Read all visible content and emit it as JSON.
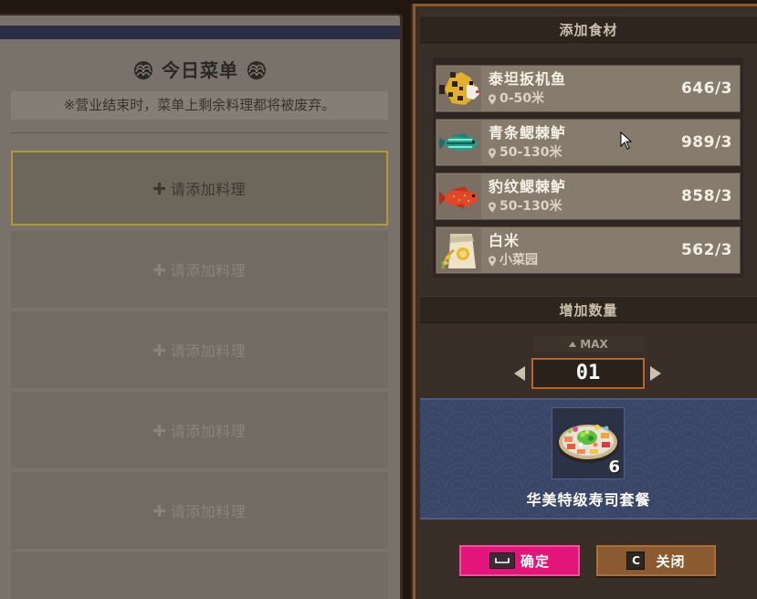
{
  "menu": {
    "title": "今日菜单",
    "notice": "※营业结束时，菜单上剩余料理都将被废弃。",
    "slots": [
      "请添加料理",
      "请添加料理",
      "请添加料理",
      "请添加料理",
      "请添加料理"
    ]
  },
  "ingredients": {
    "title": "添加食材",
    "items": [
      {
        "name": "泰坦扳机鱼",
        "location": "0-50米",
        "count": "646/3",
        "icon": "titan-triggerfish-icon"
      },
      {
        "name": "青条鳃棘鲈",
        "location": "50-130米",
        "count": "989/3",
        "icon": "blue-lined-coral-grouper-icon"
      },
      {
        "name": "豹纹鳃棘鲈",
        "location": "50-130米",
        "count": "858/3",
        "icon": "leopard-coral-grouper-icon"
      },
      {
        "name": "白米",
        "location": "小菜园",
        "count": "562/3",
        "icon": "rice-bag-icon"
      }
    ]
  },
  "quantity": {
    "title": "增加数量",
    "max_label": "MAX",
    "value": "01"
  },
  "dish": {
    "name": "华美特级寿司套餐",
    "count": "6",
    "icon": "sushi-platter-icon"
  },
  "buttons": {
    "confirm": {
      "label": "确定",
      "key_icon": "spacebar-key-icon"
    },
    "close": {
      "label": "关闭",
      "key": "C"
    }
  },
  "colors": {
    "confirm_button": "#e2157b",
    "close_button": "#8c5a31",
    "active_slot_border": "#b39a30",
    "quantity_border": "#b8652f",
    "dish_banner": "#3a4668"
  }
}
